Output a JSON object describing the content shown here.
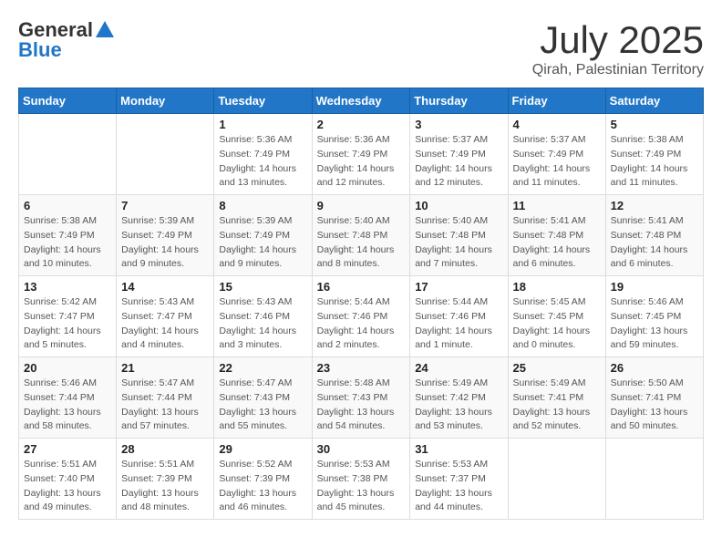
{
  "header": {
    "logo_general": "General",
    "logo_blue": "Blue",
    "month_title": "July 2025",
    "subtitle": "Qirah, Palestinian Territory"
  },
  "weekdays": [
    "Sunday",
    "Monday",
    "Tuesday",
    "Wednesday",
    "Thursday",
    "Friday",
    "Saturday"
  ],
  "weeks": [
    [
      {
        "day": null,
        "info": ""
      },
      {
        "day": null,
        "info": ""
      },
      {
        "day": "1",
        "info": "Sunrise: 5:36 AM\nSunset: 7:49 PM\nDaylight: 14 hours and 13 minutes."
      },
      {
        "day": "2",
        "info": "Sunrise: 5:36 AM\nSunset: 7:49 PM\nDaylight: 14 hours and 12 minutes."
      },
      {
        "day": "3",
        "info": "Sunrise: 5:37 AM\nSunset: 7:49 PM\nDaylight: 14 hours and 12 minutes."
      },
      {
        "day": "4",
        "info": "Sunrise: 5:37 AM\nSunset: 7:49 PM\nDaylight: 14 hours and 11 minutes."
      },
      {
        "day": "5",
        "info": "Sunrise: 5:38 AM\nSunset: 7:49 PM\nDaylight: 14 hours and 11 minutes."
      }
    ],
    [
      {
        "day": "6",
        "info": "Sunrise: 5:38 AM\nSunset: 7:49 PM\nDaylight: 14 hours and 10 minutes."
      },
      {
        "day": "7",
        "info": "Sunrise: 5:39 AM\nSunset: 7:49 PM\nDaylight: 14 hours and 9 minutes."
      },
      {
        "day": "8",
        "info": "Sunrise: 5:39 AM\nSunset: 7:49 PM\nDaylight: 14 hours and 9 minutes."
      },
      {
        "day": "9",
        "info": "Sunrise: 5:40 AM\nSunset: 7:48 PM\nDaylight: 14 hours and 8 minutes."
      },
      {
        "day": "10",
        "info": "Sunrise: 5:40 AM\nSunset: 7:48 PM\nDaylight: 14 hours and 7 minutes."
      },
      {
        "day": "11",
        "info": "Sunrise: 5:41 AM\nSunset: 7:48 PM\nDaylight: 14 hours and 6 minutes."
      },
      {
        "day": "12",
        "info": "Sunrise: 5:41 AM\nSunset: 7:48 PM\nDaylight: 14 hours and 6 minutes."
      }
    ],
    [
      {
        "day": "13",
        "info": "Sunrise: 5:42 AM\nSunset: 7:47 PM\nDaylight: 14 hours and 5 minutes."
      },
      {
        "day": "14",
        "info": "Sunrise: 5:43 AM\nSunset: 7:47 PM\nDaylight: 14 hours and 4 minutes."
      },
      {
        "day": "15",
        "info": "Sunrise: 5:43 AM\nSunset: 7:46 PM\nDaylight: 14 hours and 3 minutes."
      },
      {
        "day": "16",
        "info": "Sunrise: 5:44 AM\nSunset: 7:46 PM\nDaylight: 14 hours and 2 minutes."
      },
      {
        "day": "17",
        "info": "Sunrise: 5:44 AM\nSunset: 7:46 PM\nDaylight: 14 hours and 1 minute."
      },
      {
        "day": "18",
        "info": "Sunrise: 5:45 AM\nSunset: 7:45 PM\nDaylight: 14 hours and 0 minutes."
      },
      {
        "day": "19",
        "info": "Sunrise: 5:46 AM\nSunset: 7:45 PM\nDaylight: 13 hours and 59 minutes."
      }
    ],
    [
      {
        "day": "20",
        "info": "Sunrise: 5:46 AM\nSunset: 7:44 PM\nDaylight: 13 hours and 58 minutes."
      },
      {
        "day": "21",
        "info": "Sunrise: 5:47 AM\nSunset: 7:44 PM\nDaylight: 13 hours and 57 minutes."
      },
      {
        "day": "22",
        "info": "Sunrise: 5:47 AM\nSunset: 7:43 PM\nDaylight: 13 hours and 55 minutes."
      },
      {
        "day": "23",
        "info": "Sunrise: 5:48 AM\nSunset: 7:43 PM\nDaylight: 13 hours and 54 minutes."
      },
      {
        "day": "24",
        "info": "Sunrise: 5:49 AM\nSunset: 7:42 PM\nDaylight: 13 hours and 53 minutes."
      },
      {
        "day": "25",
        "info": "Sunrise: 5:49 AM\nSunset: 7:41 PM\nDaylight: 13 hours and 52 minutes."
      },
      {
        "day": "26",
        "info": "Sunrise: 5:50 AM\nSunset: 7:41 PM\nDaylight: 13 hours and 50 minutes."
      }
    ],
    [
      {
        "day": "27",
        "info": "Sunrise: 5:51 AM\nSunset: 7:40 PM\nDaylight: 13 hours and 49 minutes."
      },
      {
        "day": "28",
        "info": "Sunrise: 5:51 AM\nSunset: 7:39 PM\nDaylight: 13 hours and 48 minutes."
      },
      {
        "day": "29",
        "info": "Sunrise: 5:52 AM\nSunset: 7:39 PM\nDaylight: 13 hours and 46 minutes."
      },
      {
        "day": "30",
        "info": "Sunrise: 5:53 AM\nSunset: 7:38 PM\nDaylight: 13 hours and 45 minutes."
      },
      {
        "day": "31",
        "info": "Sunrise: 5:53 AM\nSunset: 7:37 PM\nDaylight: 13 hours and 44 minutes."
      },
      {
        "day": null,
        "info": ""
      },
      {
        "day": null,
        "info": ""
      }
    ]
  ]
}
